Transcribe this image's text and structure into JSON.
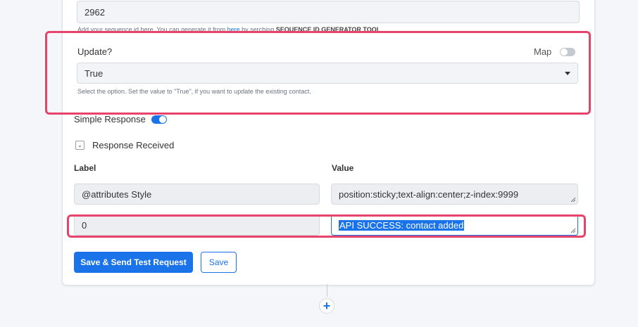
{
  "sequence": {
    "value": "2962",
    "help_prefix": "Add your sequence id here. You can generate it from ",
    "help_link": "here",
    "help_middle": " by serching ",
    "help_bold": "SEQUENCE ID GENERATOR TOOL"
  },
  "update": {
    "label": "Update?",
    "map_label": "Map",
    "map_enabled": false,
    "selected": "True",
    "help": "Select the option. Set the value to \"True\", if you want to update the existing contact."
  },
  "simple_response": {
    "label": "Simple Response",
    "enabled": true
  },
  "response_received": {
    "label": "Response Received",
    "expanded": true
  },
  "table": {
    "label_header": "Label",
    "value_header": "Value",
    "rows": [
      {
        "label": "@attributes Style",
        "value": "position:sticky;text-align:center;z-index:9999"
      },
      {
        "label": "0",
        "value": "API SUCCESS: contact added"
      }
    ]
  },
  "buttons": {
    "save_send": "Save & Send Test Request",
    "save": "Save"
  },
  "add_step": "+",
  "colors": {
    "accent": "#1a73e8",
    "highlight": "#e8436b"
  }
}
